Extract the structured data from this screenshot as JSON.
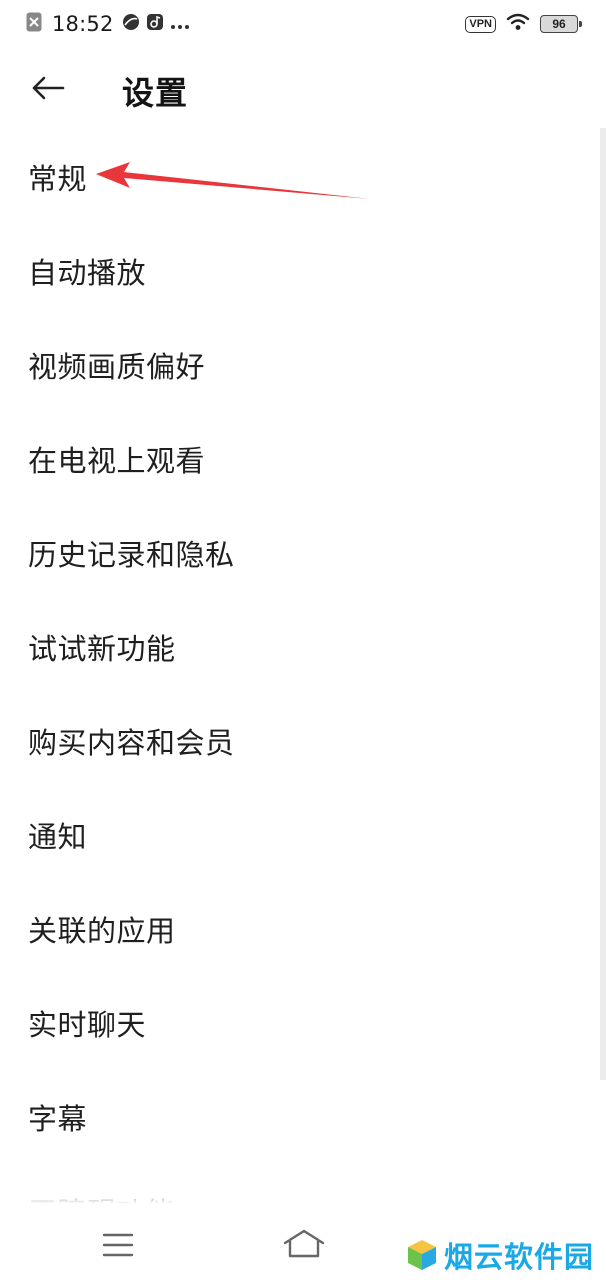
{
  "status_bar": {
    "time": "18:52",
    "vpn": "VPN",
    "battery": "96"
  },
  "header": {
    "title": "设置"
  },
  "settings": {
    "items": [
      "常规",
      "自动播放",
      "视频画质偏好",
      "在电视上观看",
      "历史记录和隐私",
      "试试新功能",
      "购买内容和会员",
      "通知",
      "关联的应用",
      "实时聊天",
      "字幕",
      "无障碍功能"
    ]
  },
  "watermark": {
    "text": "烟云软件园"
  },
  "colors": {
    "annotation_arrow": "#e8363a",
    "watermark": "#1aa9e6"
  }
}
